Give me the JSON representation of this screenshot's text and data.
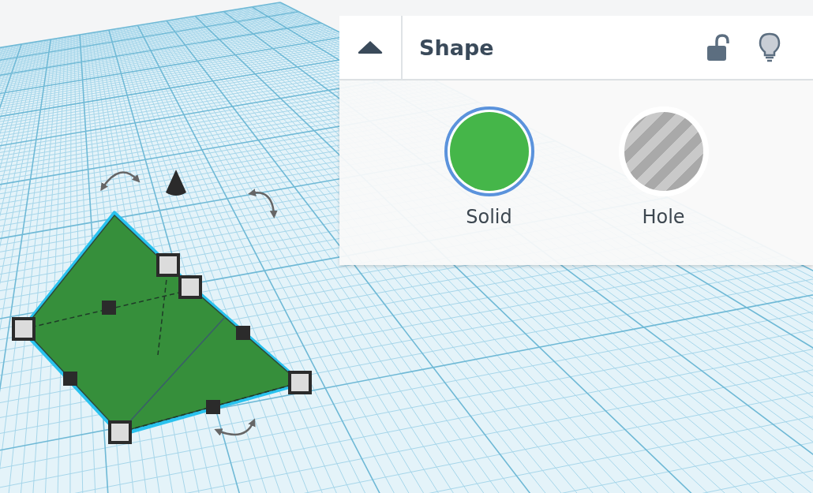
{
  "panel": {
    "title": "Shape",
    "locked": false,
    "options": [
      {
        "label": "Solid",
        "kind": "solid",
        "selected": true
      },
      {
        "label": "Hole",
        "kind": "hole",
        "selected": false
      }
    ]
  }
}
